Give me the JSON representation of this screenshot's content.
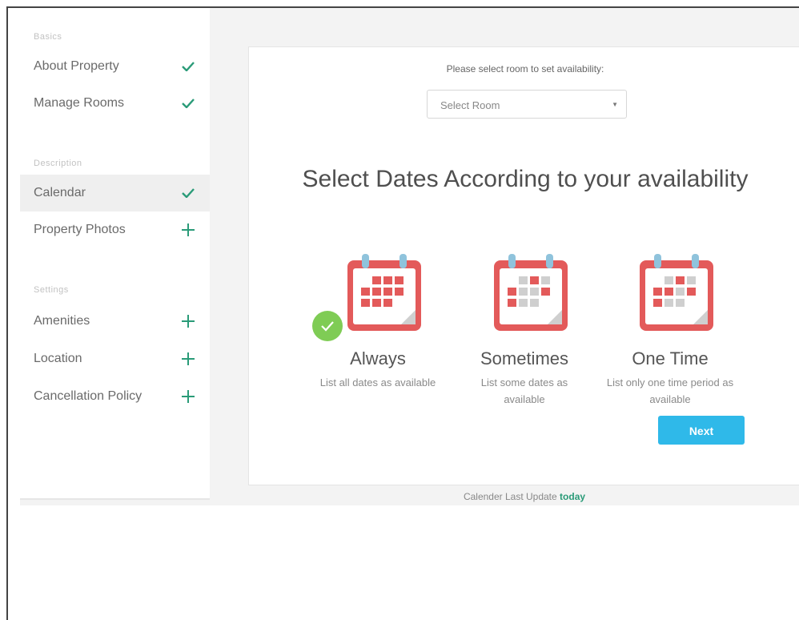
{
  "sidebar": {
    "sections": [
      {
        "title": "Basics",
        "items": [
          {
            "label": "About Property",
            "status": "done"
          },
          {
            "label": "Manage Rooms",
            "status": "done"
          }
        ]
      },
      {
        "title": "Description",
        "items": [
          {
            "label": "Calendar",
            "status": "done",
            "active": true
          },
          {
            "label": "Property Photos",
            "status": "add"
          }
        ]
      },
      {
        "title": "Settings",
        "items": [
          {
            "label": "Amenities",
            "status": "add"
          },
          {
            "label": "Location",
            "status": "add"
          },
          {
            "label": "Cancellation Policy",
            "status": "add"
          }
        ]
      }
    ]
  },
  "main": {
    "prompt": "Please select room to set availability:",
    "room_select": {
      "value": "Select Room"
    },
    "headline": "Select Dates According to your availability",
    "options": [
      {
        "title": "Always",
        "description": "List all dates as available",
        "selected": true
      },
      {
        "title": "Sometimes",
        "description": "List some dates as available",
        "selected": false
      },
      {
        "title": "One Time",
        "description": "List only one time period as available",
        "selected": false
      }
    ],
    "next_label": "Next"
  },
  "footer": {
    "text": "Calender Last Update",
    "highlight": "today"
  },
  "colors": {
    "accent_green": "#2a9b78",
    "calendar_red": "#e35a5a",
    "next_blue": "#2fb9e9",
    "selected_badge": "#7fcc55"
  }
}
